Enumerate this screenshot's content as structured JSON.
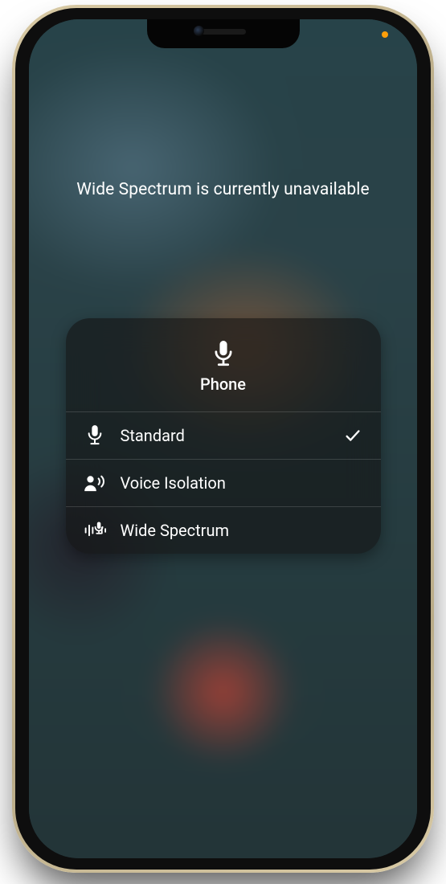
{
  "status_message": "Wide Spectrum is currently unavailable",
  "card": {
    "header_icon": "microphone-icon",
    "title": "Phone",
    "options": [
      {
        "icon": "microphone-icon",
        "label": "Standard",
        "selected": true
      },
      {
        "icon": "voice-isolation-icon",
        "label": "Voice Isolation",
        "selected": false
      },
      {
        "icon": "wide-spectrum-icon",
        "label": "Wide Spectrum",
        "selected": false
      }
    ]
  },
  "status_bar": {
    "mic_indicator_color": "#ff9f0a"
  }
}
